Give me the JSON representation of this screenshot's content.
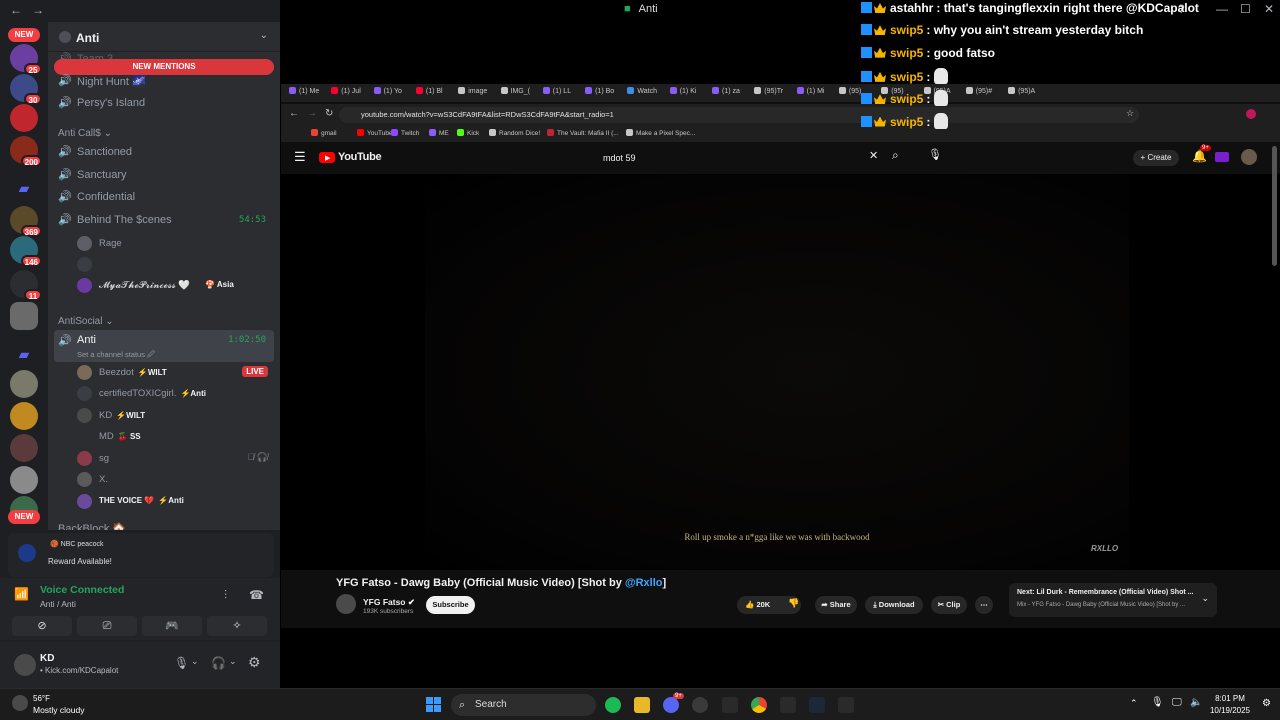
{
  "discord": {
    "badges": {
      "new_top": "NEW",
      "new_bottom": "NEW",
      "g1": "25",
      "g2": "30",
      "g3": "200",
      "g4": "369",
      "g5": "146",
      "g6": "11"
    },
    "server_name": "Anti",
    "new_mentions": "NEW MENTIONS",
    "channels_top": [
      "Team 3",
      "Night Hunt 🌌",
      "Persy's Island"
    ],
    "category1": "Anti Call$ ⌄",
    "channels_cat1": [
      "Sanctioned",
      "Sanctuary",
      "Confidential"
    ],
    "behind_scenes": {
      "label": "Behind The $cenes",
      "time": "54:53"
    },
    "behind_users": [
      {
        "name": "Rage",
        "tag": ""
      },
      {
        "name": "",
        "tag": ""
      },
      {
        "name": "𝓜𝔂𝓪𝓣𝓱𝓮𝓟𝓻𝓲𝓷𝓬𝓮𝓼𝓼 🤍",
        "tag": "🍄 Asia"
      }
    ],
    "category2": "AntiSocial ⌄",
    "anti_channel": {
      "label": "Anti",
      "time": "1:02:50",
      "status": "Set a channel status 🖉"
    },
    "anti_users": [
      {
        "name": "Beezdot",
        "tag": "⚡WILT",
        "live": "LIVE"
      },
      {
        "name": "certifiedTOXICgirl.",
        "tag": "⚡Anti"
      },
      {
        "name": "KD",
        "tag": "⚡WILT"
      },
      {
        "name": "MD",
        "tag": "🍒 SS"
      },
      {
        "name": "sg",
        "tag": ""
      },
      {
        "name": "X.",
        "tag": ""
      },
      {
        "name": "THE VOICE 💔",
        "tag": "⚡Anti"
      }
    ],
    "backblock": "BackBlock 🏠",
    "reward": {
      "brand": "🏀 NBC peacock",
      "text": "Reward Available!"
    },
    "voice": {
      "status": "Voice Connected",
      "sub": "Anti / Anti"
    },
    "user": {
      "name": "KD",
      "status": "• Kick.com/KDCapalot"
    }
  },
  "chat": [
    {
      "user": "astahhr",
      "user_color": "#ffffff",
      "text": ": that's tangingflexxin right there @KDCapalot",
      "emote": false
    },
    {
      "user": "swip5",
      "user_color": "#f5b400",
      "text": ": why you ain't stream yesterday bitch",
      "emote": false
    },
    {
      "user": "swip5",
      "user_color": "#f5b400",
      "text": ": good fatso",
      "emote": false
    },
    {
      "user": "swip5",
      "user_color": "#f5b400",
      "text": ":",
      "emote": true
    },
    {
      "user": "swip5",
      "user_color": "#f5b400",
      "text": ":",
      "emote": true
    },
    {
      "user": "swip5",
      "user_color": "#f5b400",
      "text": ":",
      "emote": true
    }
  ],
  "window_title": "Anti",
  "browser": {
    "tabs": [
      "(1) Me",
      "(1) Jul",
      "(1) Yo",
      "(1) Bl",
      "image",
      "IMG_(",
      "(1) LL",
      "(1) Bo",
      "Watch",
      "(1) Ki",
      "(1) za",
      "(95)Tr",
      "(1) Mi",
      "(95)",
      "(95)",
      "(95)A",
      "(95)#",
      "(95)A"
    ],
    "url": "youtube.com/watch?v=wS3CdFA9tFA&list=RDwS3CdFA9tFA&start_radio=1",
    "bookmarks": [
      "gmail",
      "YouTube",
      "Twitch",
      "ME",
      "Kick",
      "Random Dice!",
      "The Vault: Mafia II (...",
      "Make a Pixel Spec..."
    ]
  },
  "youtube": {
    "logo": "YouTube",
    "search_query": "mdot 59",
    "create_label": "Create",
    "notif_count": "9+",
    "subtitle": "Roll up smoke a n*gga like we was with backwood",
    "watermark": "RXLLO",
    "title_main": "YFG Fatso - Dawg Baby (Official Music Video) [Shot by ",
    "title_link": "@Rxllo",
    "title_end": "]",
    "channel": "YFG Fatso ✔",
    "subscribers": "193K subscribers",
    "subscribe_label": "Subscribe",
    "likes": "20K",
    "share_label": "Share",
    "download_label": "Download",
    "clip_label": "Clip",
    "next_title": "Next: Lil Durk - Remembrance (Official Video) Shot ...",
    "next_sub": "Mix - YFG Fatso - Dawg Baby (Official Music Video) [Shot by ..."
  },
  "taskbar": {
    "weather_temp": "56°F",
    "weather_desc": "Mostly cloudy",
    "search_label": "Search",
    "discord_badge": "9+",
    "time": "8:01 PM",
    "date": "10/19/2025"
  }
}
